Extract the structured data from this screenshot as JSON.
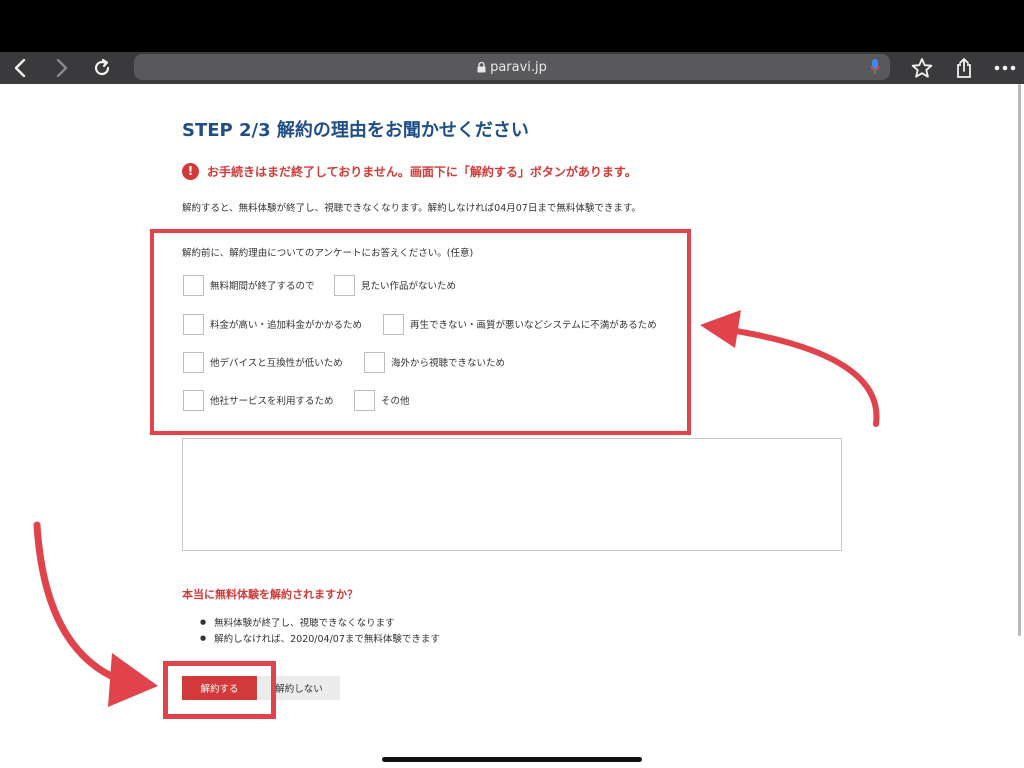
{
  "browser": {
    "url": "paravi.jp",
    "icons": {
      "back": "chevron-left-icon",
      "forward": "chevron-right-icon",
      "reload": "reload-icon",
      "lock": "lock-icon",
      "mic": "mic-icon",
      "bookmark": "star-icon",
      "share": "share-icon",
      "more": "more-dots-icon"
    }
  },
  "page": {
    "title": "STEP 2/3 解約の理由をお聞かせください",
    "notice": "お手続きはまだ終了しておりません。画面下に「解約する」ボタンがあります。",
    "description": "解約すると、無料体験が終了し、視聴できなくなります。解約しなければ04月07日まで無料体験できます。",
    "survey": {
      "intro": "解約前に、解約理由についてのアンケートにお答えください。(任意)",
      "options": [
        "無料期間が終了するので",
        "見たい作品がないため",
        "料金が高い・追加料金がかかるため",
        "再生できない・画質が悪いなどシステムに不満があるため",
        "他デバイスと互換性が低いため",
        "海外から視聴できないため",
        "他社サービスを利用するため",
        "その他"
      ]
    },
    "confirm": {
      "heading": "本当に無料体験を解約されますか？",
      "bullets": [
        "無料体験が終了し、視聴できなくなります",
        "解約しなければ、2020/04/07まで無料体験できます"
      ]
    },
    "buttons": {
      "cancel": "解約する",
      "keep": "解約しない"
    }
  },
  "colors": {
    "title": "#1f4e87",
    "alert": "#d23a3a",
    "annotation": "#e0434c"
  }
}
